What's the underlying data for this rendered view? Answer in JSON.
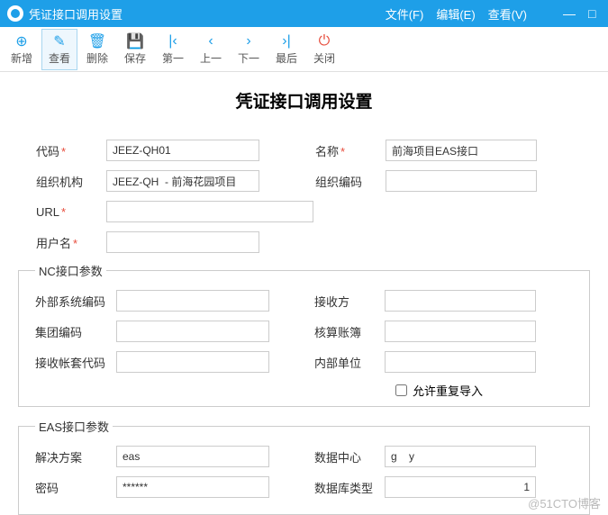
{
  "window": {
    "title": "凭证接口调用设置"
  },
  "menus": {
    "file": "文件(F)",
    "edit": "编辑(E)",
    "view": "查看(V)"
  },
  "toolbar": {
    "new": "新增",
    "view": "查看",
    "delete": "删除",
    "save": "保存",
    "first": "第一",
    "prev": "上一",
    "next": "下一",
    "last": "最后",
    "close": "关闭"
  },
  "page": {
    "heading": "凭证接口调用设置"
  },
  "form": {
    "code_label": "代码",
    "code": "JEEZ-QH01",
    "name_label": "名称",
    "name": "前海项目EAS接口",
    "org_label": "组织机构",
    "org": "JEEZ-QH  - 前海花园项目",
    "orgcode_label": "组织编码",
    "orgcode": "",
    "url_label": "URL",
    "url": "",
    "user_label": "用户名",
    "user": ""
  },
  "nc": {
    "legend": "NC接口参数",
    "ext_label": "外部系统编码",
    "ext": "",
    "recv_label": "接收方",
    "recv": "",
    "group_label": "集团编码",
    "group": "",
    "ledger_label": "核算账簿",
    "ledger": "",
    "acct_label": "接收帐套代码",
    "acct": "",
    "unit_label": "内部单位",
    "unit": "",
    "reimport_label": "允许重复导入"
  },
  "eas": {
    "legend": "EAS接口参数",
    "sol_label": "解决方案",
    "sol": "eas",
    "dc_label": "数据中心",
    "dc": "g    y",
    "pwd_label": "密码",
    "pwd": "******",
    "dbtype_label": "数据库类型",
    "dbtype": "1"
  },
  "watermark": "@51CTO博客"
}
